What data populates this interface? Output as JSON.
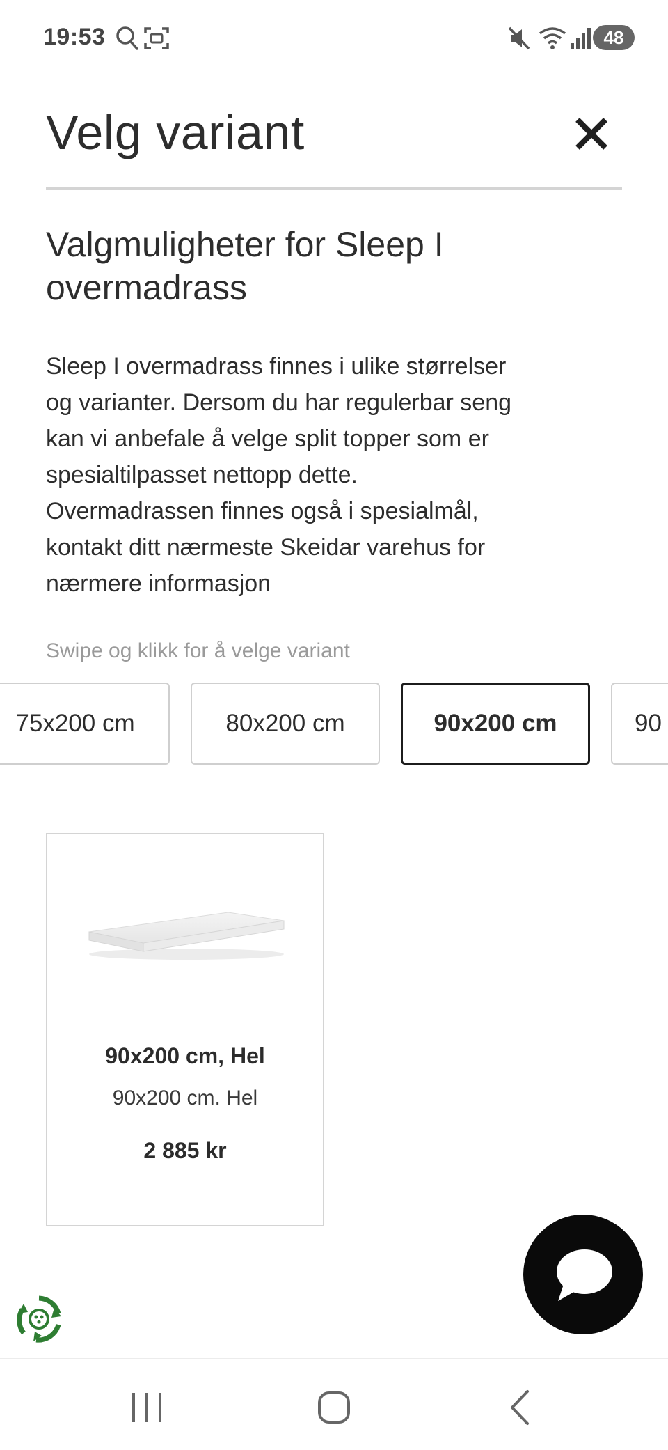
{
  "status_bar": {
    "time": "19:53",
    "battery": "48",
    "icons": [
      "search-icon",
      "screen-capture-icon",
      "mute-icon",
      "wifi-icon",
      "signal-icon",
      "battery-icon"
    ]
  },
  "header": {
    "title": "Velg variant",
    "close_icon": "close-icon"
  },
  "section": {
    "title": "Valgmuligheter for Sleep I overmadrass",
    "description": "Sleep I overmadrass finnes i ulike størrelser\nog varianter. Dersom du har regulerbar seng\nkan vi anbefale å velge split topper som er\nspesialtilpasset nettopp dette.\nOvermadrassen finnes også i spesialmål,\nkontakt ditt nærmeste Skeidar varehus for\nnærmere informasjon",
    "swipe_hint": "Swipe og klikk for å velge variant"
  },
  "variants": [
    {
      "label": "75x200 cm",
      "selected": false
    },
    {
      "label": "80x200 cm",
      "selected": false
    },
    {
      "label": "90x200 cm",
      "selected": true
    },
    {
      "label": "90",
      "selected": false
    }
  ],
  "product": {
    "name": "90x200 cm, Hel",
    "subtitle": "90x200 cm. Hel",
    "price": "2 885 kr",
    "image": "mattress-topper-image"
  },
  "chat_button": {
    "icon": "chat-bubble-icon"
  },
  "recycle_badge": {
    "icon": "recycle-icon"
  },
  "nav_bar": {
    "icons": [
      "recent-apps-icon",
      "home-icon",
      "back-icon"
    ]
  },
  "colors": {
    "text": "#2d2d2d",
    "muted": "#9a9a9a",
    "border": "#d4d4d4",
    "selected_border": "#1c1c1c",
    "chat_fab": "#0a0a0a",
    "recycle_green": "#2e7d32"
  }
}
